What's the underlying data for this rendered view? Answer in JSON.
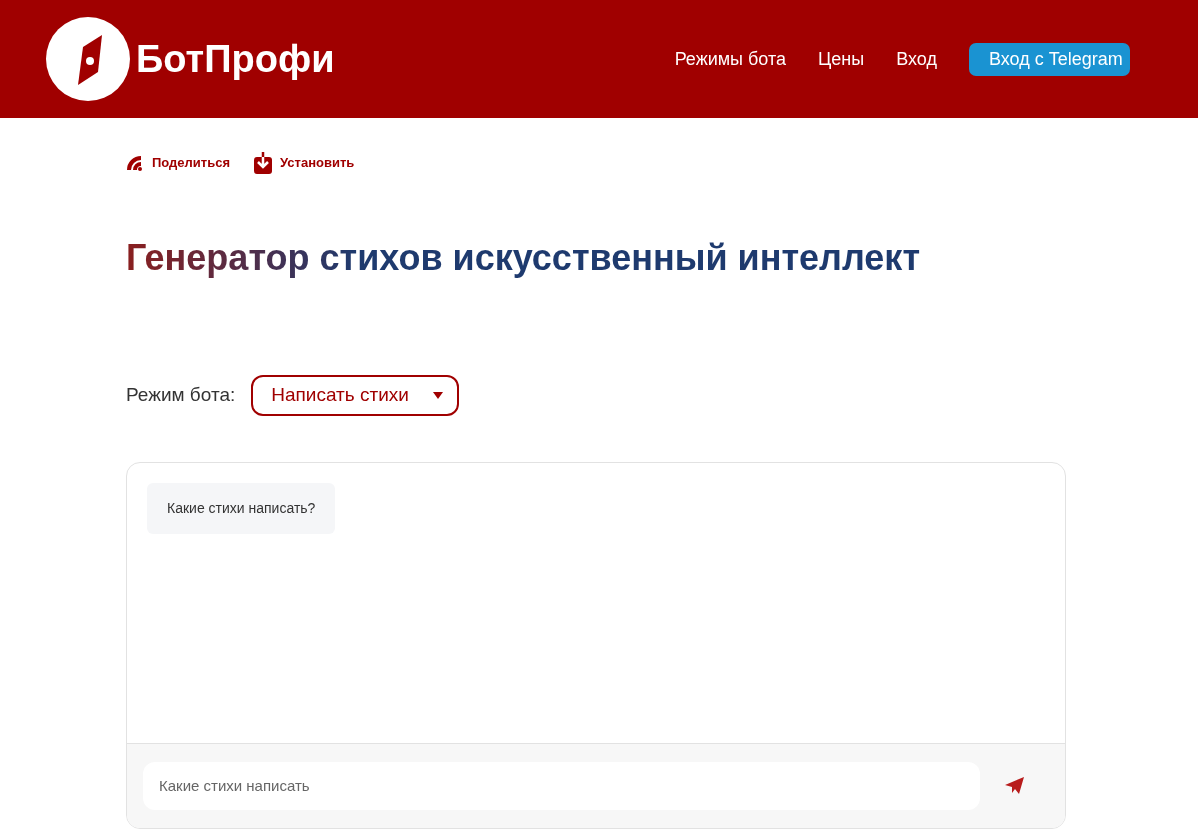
{
  "header": {
    "brand": "БотПрофи",
    "nav": [
      {
        "label": "Режимы бота",
        "kind": "link"
      },
      {
        "label": "Цены",
        "kind": "link"
      },
      {
        "label": "Вход",
        "kind": "link"
      },
      {
        "label": "Вход с Telegram",
        "kind": "button"
      }
    ]
  },
  "actions": [
    {
      "label": "Поделиться",
      "kind": "share"
    },
    {
      "label": "Установить",
      "kind": "install"
    }
  ],
  "title": "Генератор стихов искусственный интеллект",
  "mode": {
    "label": "Режим бота:",
    "value": "Написать стихи"
  },
  "chat": {
    "messages": [
      "Какие стихи написать?"
    ],
    "input": {
      "placeholder": "Какие стихи написать"
    }
  }
}
